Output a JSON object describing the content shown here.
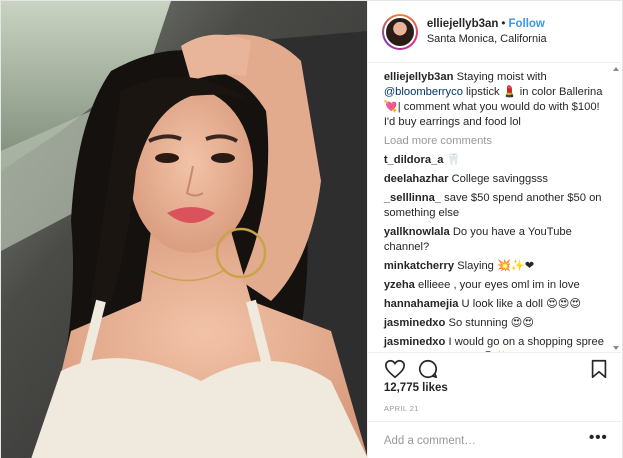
{
  "header": {
    "username": "elliejellyb3an",
    "separator": "•",
    "follow_label": "Follow",
    "location": "Santa Monica, California"
  },
  "caption": {
    "username": "elliejellyb3an",
    "text_1": "Staying moist with ",
    "mention": "@bloomberryco",
    "text_2": " lipstick 💄 in color Ballerina 💘| comment what you would do with $100! I'd buy earrings and food lol"
  },
  "load_more_label": "Load more comments",
  "comments": [
    {
      "user": "t_dildora_a",
      "text": "🦷"
    },
    {
      "user": "deelahazhar",
      "text": "College savinggsss"
    },
    {
      "user": "_selllinna_",
      "text": "save $50 spend another $50 on something else"
    },
    {
      "user": "yallknowlala",
      "text": "Do you have a YouTube channel?"
    },
    {
      "user": "minkatcherry",
      "text": "Slaying 💥✨❤"
    },
    {
      "user": "yzeha",
      "text": "ellieee , your eyes oml im in love"
    },
    {
      "user": "hannahamejia",
      "text": "U look like a doll 😍😍😍"
    },
    {
      "user": "jasminedxo",
      "text": "So stunning 😍😍"
    },
    {
      "user": "jasminedxo",
      "text": "I would go on a shopping spree and buy lots of food😂✨"
    }
  ],
  "actions": {
    "like_icon": "heart-icon",
    "comment_icon": "comment-icon",
    "save_icon": "bookmark-icon"
  },
  "likes": "12,775 likes",
  "date": "APRIL 21",
  "add_comment": {
    "placeholder": "Add a comment…",
    "more_label": "•••"
  },
  "colors": {
    "accent": "#3897f0",
    "muted": "#999999",
    "border": "#efefef"
  }
}
